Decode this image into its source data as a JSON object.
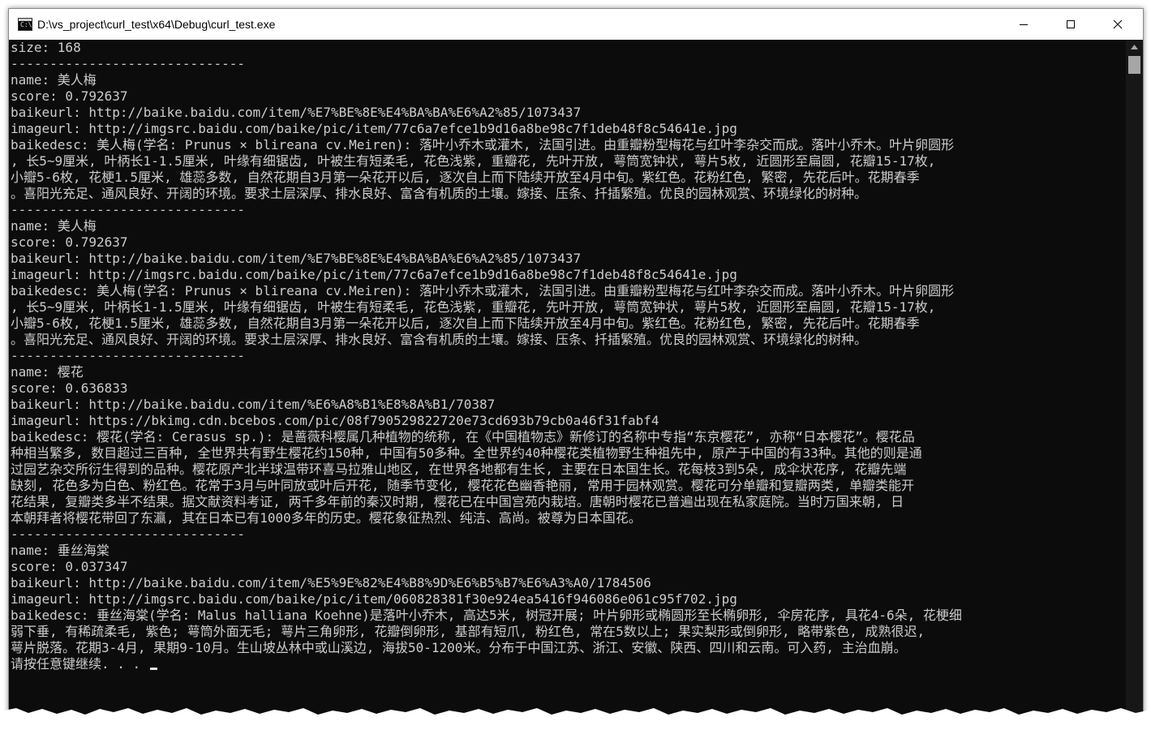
{
  "window": {
    "title": "D:\\vs_project\\curl_test\\x64\\Debug\\curl_test.exe"
  },
  "console": {
    "lines": [
      "size: 168",
      "------------------------------",
      "name: 美人梅",
      "score: 0.792637",
      "baikeurl: http://baike.baidu.com/item/%E7%BE%8E%E4%BA%BA%E6%A2%85/1073437",
      "imageurl: http://imgsrc.baidu.com/baike/pic/item/77c6a7efce1b9d16a8be98c7f1deb48f8c54641e.jpg",
      "baikedesc: 美人梅(学名: Prunus × blireana cv.Meiren): 落叶小乔木或灌木, 法国引进。由重瓣粉型梅花与红叶李杂交而成。落叶小乔木。叶片卵圆形",
      ", 长5~9厘米, 叶柄长1-1.5厘米, 叶缘有细锯齿, 叶被生有短柔毛, 花色浅紫, 重瓣花, 先叶开放, 萼筒宽钟状, 萼片5枚, 近圆形至扁圆, 花瓣15-17枚,",
      "小瓣5-6枚, 花梗1.5厘米, 雄蕊多数, 自然花期自3月第一朵花开以后, 逐次自上而下陆续开放至4月中旬。紫红色。花粉红色, 繁密, 先花后叶。花期春季",
      "。喜阳光充足、通风良好、开阔的环境。要求土层深厚、排水良好、富含有机质的土壤。嫁接、压条、扦插繁殖。优良的园林观赏、环境绿化的树种。",
      "------------------------------",
      "name: 美人梅",
      "score: 0.792637",
      "baikeurl: http://baike.baidu.com/item/%E7%BE%8E%E4%BA%BA%E6%A2%85/1073437",
      "imageurl: http://imgsrc.baidu.com/baike/pic/item/77c6a7efce1b9d16a8be98c7f1deb48f8c54641e.jpg",
      "baikedesc: 美人梅(学名: Prunus × blireana cv.Meiren): 落叶小乔木或灌木, 法国引进。由重瓣粉型梅花与红叶李杂交而成。落叶小乔木。叶片卵圆形",
      ", 长5~9厘米, 叶柄长1-1.5厘米, 叶缘有细锯齿, 叶被生有短柔毛, 花色浅紫, 重瓣花, 先叶开放, 萼筒宽钟状, 萼片5枚, 近圆形至扁圆, 花瓣15-17枚,",
      "小瓣5-6枚, 花梗1.5厘米, 雄蕊多数, 自然花期自3月第一朵花开以后, 逐次自上而下陆续开放至4月中旬。紫红色。花粉红色, 繁密, 先花后叶。花期春季",
      "。喜阳光充足、通风良好、开阔的环境。要求土层深厚、排水良好、富含有机质的土壤。嫁接、压条、扦插繁殖。优良的园林观赏、环境绿化的树种。",
      "------------------------------",
      "name: 樱花",
      "score: 0.636833",
      "baikeurl: http://baike.baidu.com/item/%E6%A8%B1%E8%8A%B1/70387",
      "imageurl: https://bkimg.cdn.bcebos.com/pic/08f790529822720e73cd693b79cb0a46f31fabf4",
      "baikedesc: 樱花(学名: Cerasus sp.): 是蔷薇科樱属几种植物的统称, 在《中国植物志》新修订的名称中专指“东京樱花”, 亦称“日本樱花”。樱花品",
      "种相当繁多, 数目超过三百种, 全世界共有野生樱花约150种, 中国有50多种。全世界约40种樱花类植物野生种祖先中, 原产于中国的有33种。其他的则是通",
      "过园艺杂交所衍生得到的品种。樱花原产北半球温带环喜马拉雅山地区, 在世界各地都有生长, 主要在日本国生长。花每枝3到5朵, 成伞状花序, 花瓣先端",
      "缺刻, 花色多为白色、粉红色。花常于3月与叶同放或叶后开花, 随季节变化, 樱花花色幽香艳丽, 常用于园林观赏。樱花可分单瓣和复瓣两类, 单瓣类能开",
      "花结果, 复瓣类多半不结果。据文献资料考证, 两千多年前的秦汉时期, 樱花已在中国宫苑内栽培。唐朝时樱花已普遍出现在私家庭院。当时万国来朝, 日",
      "本朝拜者将樱花带回了东瀛, 其在日本已有1000多年的历史。樱花象征热烈、纯洁、高尚。被尊为日本国花。",
      "------------------------------",
      "name: 垂丝海棠",
      "score: 0.037347",
      "baikeurl: http://baike.baidu.com/item/%E5%9E%82%E4%B8%9D%E6%B5%B7%E6%A3%A0/1784506",
      "imageurl: http://imgsrc.baidu.com/baike/pic/item/060828381f30e924ea5416f946086e061c95f702.jpg",
      "baikedesc: 垂丝海棠(学名: Malus halliana Koehne)是落叶小乔木, 高达5米, 树冠开展; 叶片卵形或椭圆形至长椭卵形, 伞房花序, 具花4-6朵, 花梗细",
      "弱下垂, 有稀疏柔毛, 紫色; 萼筒外面无毛; 萼片三角卵形, 花瓣倒卵形, 基部有短爪, 粉红色, 常在5数以上; 果实梨形或倒卵形, 略带紫色, 成熟很迟,",
      "萼片脱落。花期3-4月, 果期9-10月。生山坡丛林中或山溪边, 海拔50-1200米。分布于中国江苏、浙江、安徽、陕西、四川和云南。可入药, 主治血崩。",
      "请按任意键继续. . . "
    ]
  }
}
